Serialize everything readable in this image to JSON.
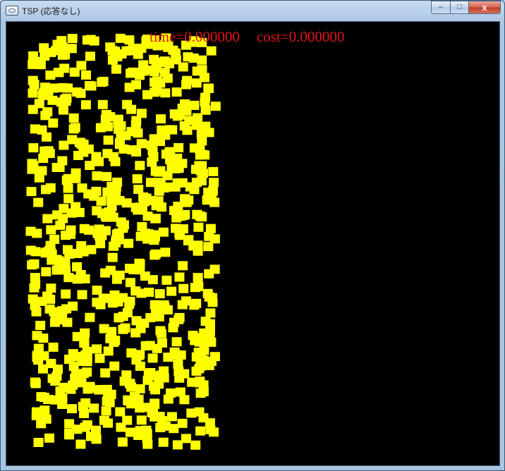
{
  "window": {
    "title": "TSP (応答なし)",
    "controls": {
      "minimize": "–",
      "maximize": "□",
      "close": "x"
    }
  },
  "status": {
    "time_text": "time=0.000000",
    "cost_text": "cost=0.000000"
  },
  "colors": {
    "canvas_background": "#000000",
    "city_fill": "#ffff00",
    "status_text": "#e0161d"
  }
}
